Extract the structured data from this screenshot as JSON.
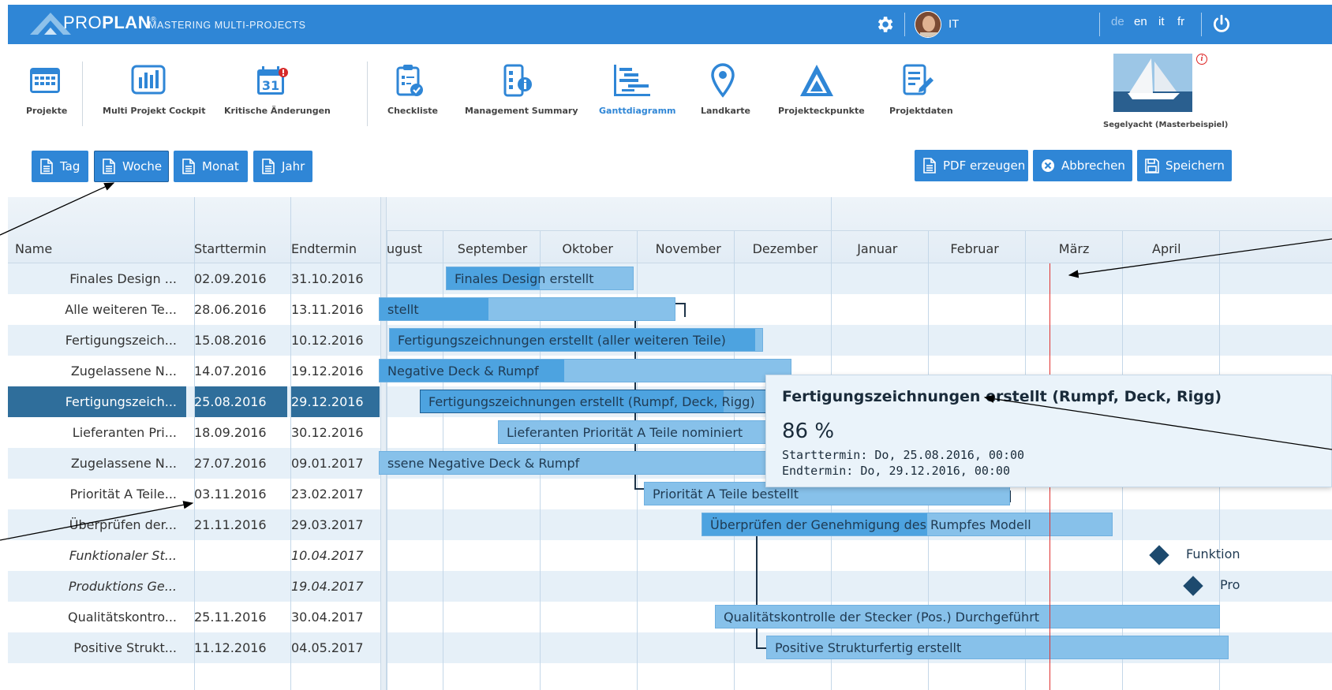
{
  "app": {
    "brand_light": "PRO",
    "brand_bold": "PLAN",
    "trademark": "®",
    "tagline": "MASTERING MULTI-PROJECTS",
    "user": "IT",
    "languages": [
      "de",
      "en",
      "it",
      "fr"
    ],
    "active_language": "de",
    "accent_color": "#2f86d6"
  },
  "nav": {
    "items": [
      {
        "label": "Projekte",
        "icon": "calendar-grid-icon"
      },
      {
        "label": "Multi Projekt Cockpit",
        "icon": "bar-chart-icon"
      },
      {
        "label": "Kritische Änderungen",
        "icon": "calendar-alert-icon",
        "calendar_day": "31"
      },
      {
        "label": "Checkliste",
        "icon": "clipboard-check-icon"
      },
      {
        "label": "Management Summary",
        "icon": "summary-list-icon"
      },
      {
        "label": "Ganttdiagramm",
        "icon": "gantt-icon",
        "active": true
      },
      {
        "label": "Landkarte",
        "icon": "map-pin-icon"
      },
      {
        "label": "Projekteckpunkte",
        "icon": "triangle-icon"
      },
      {
        "label": "Projektdaten",
        "icon": "edit-document-icon"
      }
    ],
    "project_name": "Segelyacht (Masterbeispiel)",
    "info_glyph": "i"
  },
  "toolbar": {
    "day": "Tag",
    "week": "Woche",
    "month": "Monat",
    "year": "Jahr",
    "selected_scale": "Woche",
    "pdf": "PDF erzeugen",
    "cancel": "Abbrechen",
    "save": "Speichern"
  },
  "gantt": {
    "columns": {
      "name": "Name",
      "start": "Starttermin",
      "end": "Endtermin"
    },
    "months": [
      "ugust",
      "September",
      "Oktober",
      "November",
      "Dezember",
      "Januar",
      "Februar",
      "März",
      "April"
    ],
    "rows": [
      {
        "name": "Finales Design ...",
        "start": "02.09.2016",
        "end": "31.10.2016",
        "bar_label": "Finales Design erstellt",
        "progress": 0.5
      },
      {
        "name": "Alle weiteren Te...",
        "start": "28.06.2016",
        "end": "13.11.2016",
        "bar_label": "stellt",
        "progress": 0.37
      },
      {
        "name": "Fertigungszeich...",
        "start": "15.08.2016",
        "end": "10.12.2016",
        "bar_label": "Fertigungszeichnungen erstellt (aller weiteren Teile)",
        "progress": 0.98
      },
      {
        "name": "Zugelassene N...",
        "start": "14.07.2016",
        "end": "19.12.2016",
        "bar_label": "Negative Deck & Rumpf",
        "progress": 0.45
      },
      {
        "name": "Fertigungszeich...",
        "start": "25.08.2016",
        "end": "29.12.2016",
        "bar_label": "Fertigungszeichnungen erstellt (Rumpf, Deck, Rigg)",
        "progress": 0.86,
        "selected": true
      },
      {
        "name": "Lieferanten Pri...",
        "start": "18.09.2016",
        "end": "30.12.2016",
        "bar_label": "Lieferanten Priorität A Teile nominiert",
        "progress": 0.0
      },
      {
        "name": "Zugelassene N...",
        "start": "27.07.2016",
        "end": "09.01.2017",
        "bar_label": "ssene Negative Deck & Rumpf",
        "progress": 0.0
      },
      {
        "name": "Priorität A Teile...",
        "start": "03.11.2016",
        "end": "23.02.2017",
        "bar_label": "Priorität A Teile bestellt",
        "progress": 0.0
      },
      {
        "name": "Überprüfen der...",
        "start": "21.11.2016",
        "end": "29.03.2017",
        "bar_label": "Überprüfen der Genehmigung des Rumpfes Modell",
        "progress": 0.55
      },
      {
        "name": "Funktionaler St...",
        "start": "",
        "end": "10.04.2017",
        "bar_label": "Funktion",
        "milestone": true
      },
      {
        "name": "Produktions Ge...",
        "start": "",
        "end": "19.04.2017",
        "bar_label": "Pro",
        "milestone": true
      },
      {
        "name": "Qualitätskontro...",
        "start": "25.11.2016",
        "end": "30.04.2017",
        "bar_label": "Qualitätskontrolle der Stecker (Pos.) Durchgeführt",
        "progress": 0.0
      },
      {
        "name": "Positive Strukt...",
        "start": "11.12.2016",
        "end": "04.05.2017",
        "bar_label": "Positive Strukturfertig erstellt",
        "progress": 0.0
      }
    ]
  },
  "tooltip": {
    "title": "Fertigungszeichnungen erstellt (Rumpf, Deck, Rigg)",
    "percent": "86 %",
    "start": "Starttermin: Do, 25.08.2016, 00:00",
    "end": "Endtermin: Do, 29.12.2016, 00:00"
  }
}
